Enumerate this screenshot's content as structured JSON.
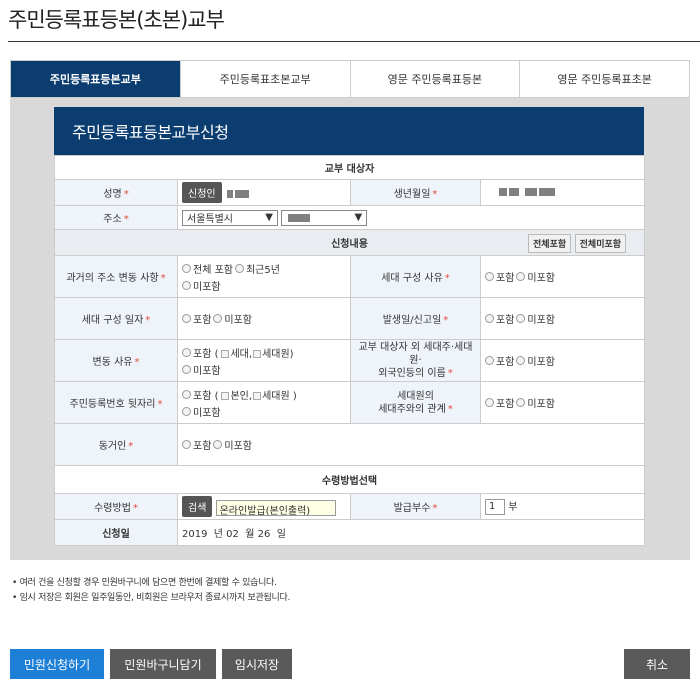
{
  "page": {
    "title": "주민등록표등본(초본)교부"
  },
  "tabs": [
    {
      "label": "주민등록표등본교부",
      "active": true
    },
    {
      "label": "주민등록표초본교부",
      "active": false
    },
    {
      "label": "영문 주민등록표등본",
      "active": false
    },
    {
      "label": "영문 주민등록표초본",
      "active": false
    }
  ],
  "form": {
    "header": "주민등록표등본교부신청",
    "target_section": "교부 대상자",
    "name_label": "성명",
    "applicant_button": "신청인",
    "birth_label": "생년월일",
    "address_label": "주소",
    "address_city": "서울특별시",
    "content_section": "신청내용",
    "include_all_button": "전체포함",
    "exclude_all_button": "전체미포함",
    "required_mark": "*",
    "rows": {
      "past_address": {
        "label": "과거의 주소 변동 사항",
        "opt_all": "전체 포함",
        "opt_recent": "최근5년",
        "opt_exclude": "미포함"
      },
      "household_reason": {
        "label": "세대 구성 사유",
        "opt_include": "포함",
        "opt_exclude": "미포함"
      },
      "household_date": {
        "label": "세대 구성 일자",
        "opt_include": "포함",
        "opt_exclude": "미포함"
      },
      "report_date": {
        "label": "발생일/신고일",
        "opt_include": "포함",
        "opt_exclude": "미포함"
      },
      "change_reason": {
        "label": "변동 사유",
        "opt_include_prefix": "포함 (",
        "opt_head": "세대,",
        "opt_member": "세대원)",
        "opt_exclude": "미포함"
      },
      "other_members": {
        "label_line1": "교부 대상자 외 세대주·세대원·",
        "label_line2": "외국인등의 이름",
        "opt_include": "포함",
        "opt_exclude": "미포함"
      },
      "rrn_suffix": {
        "label": "주민등록번호 뒷자리",
        "opt_include_prefix": "포함 (",
        "opt_self": "본인,",
        "opt_member": "세대원 )",
        "opt_exclude": "미포함"
      },
      "relation": {
        "label_line1": "세대원의",
        "label_line2": "세대주와의 관계",
        "opt_include": "포함",
        "opt_exclude": "미포함"
      },
      "cohabitant": {
        "label": "동거인",
        "opt_include": "포함",
        "opt_exclude": "미포함"
      }
    },
    "receive_section": "수령방법선택",
    "receive_label": "수령방법",
    "search_button": "검색",
    "receive_value": "온라인발급(본인출력)",
    "copies_label": "발급부수",
    "copies_value": "1",
    "copies_unit": "부",
    "apply_date_label": "신청일",
    "apply_date_value": "2019  년 02  월 26  일"
  },
  "notes": [
    "• 여러 건을 신청할 경우 민원바구니에 담으면 한번에 결제할 수 있습니다.",
    "• 임시 저장은 회원은 일주일동안, 비회원은 브라우저 종료시까지 보관됩니다."
  ],
  "buttons": {
    "apply": "민원신청하기",
    "cart": "민원바구니담기",
    "temp_save": "임시저장",
    "cancel": "취소"
  },
  "colors": {
    "navy": "#0b3d70",
    "label_bg": "#eef4fa",
    "accent_blue": "#1e7fd6",
    "required": "#e04a3b"
  }
}
